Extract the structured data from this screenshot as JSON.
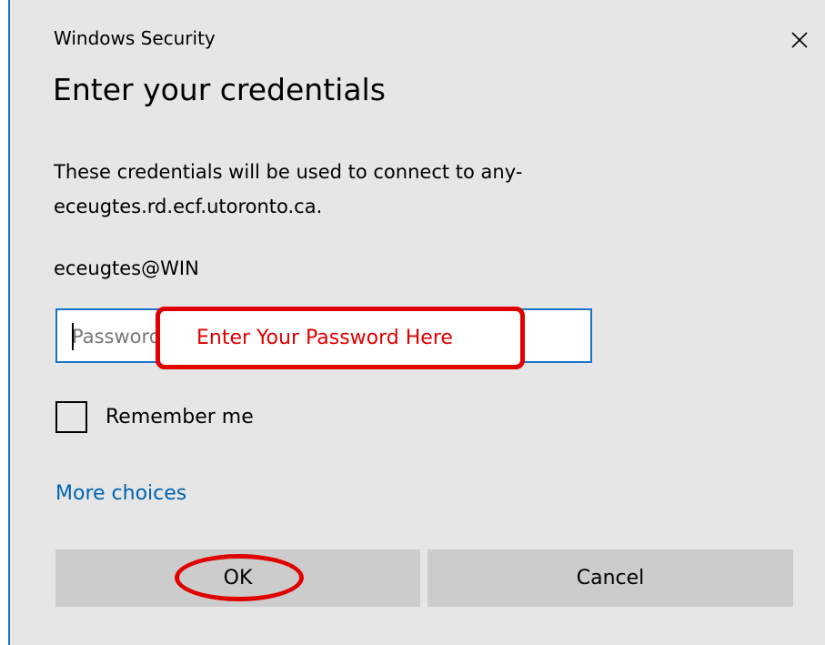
{
  "window": {
    "title": "Windows Security",
    "close_icon": "close-icon"
  },
  "heading": "Enter your credentials",
  "description": "These credentials will be used to connect to any-eceugtes.rd.ecf.utoronto.ca.",
  "username": "eceugtes@WIN",
  "password": {
    "placeholder": "Password",
    "value": ""
  },
  "annotation": {
    "text": "Enter Your Password Here",
    "color": "#e00000"
  },
  "remember": {
    "label": "Remember me",
    "checked": false
  },
  "more_choices": "More choices",
  "buttons": {
    "ok": "OK",
    "cancel": "Cancel"
  },
  "colors": {
    "accent": "#1a73c9",
    "link": "#0063b1",
    "dialog_bg": "#e6e6e6",
    "button_bg": "#cccccc"
  }
}
